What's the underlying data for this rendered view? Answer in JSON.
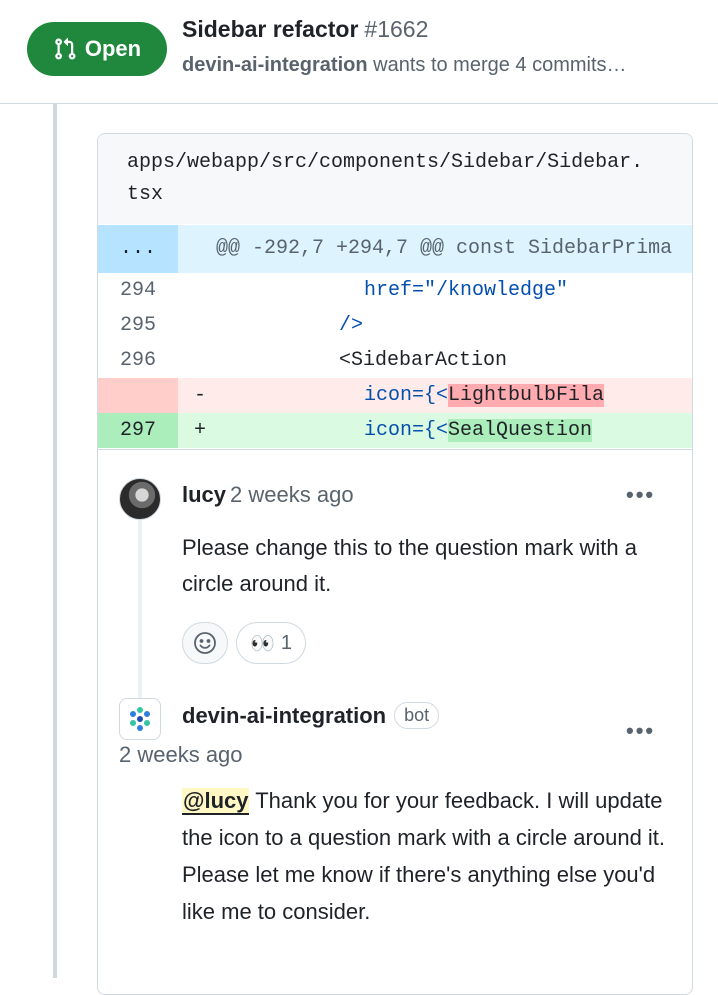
{
  "header": {
    "status_label": "Open",
    "title": "Sidebar refactor",
    "number": "#1662",
    "author": "devin-ai-integration",
    "meta_text": "wants to merge 4 commits…"
  },
  "file": {
    "path": "apps/webapp/src/components/Sidebar/Sidebar.tsx"
  },
  "diff": {
    "hunk_gutter": "...",
    "hunk_header": "@@ -292,7 +294,7 @@ const SidebarPrima",
    "lines": [
      {
        "num": "294",
        "sign": "",
        "code": "href=\"/knowledge\""
      },
      {
        "num": "295",
        "sign": "",
        "code": "/>"
      },
      {
        "num": "296",
        "sign": "",
        "code": "<SidebarAction"
      },
      {
        "num": "",
        "sign": "-",
        "code_prefix": "icon={<",
        "code_highlight": "LightbulbFila"
      },
      {
        "num": "297",
        "sign": "+",
        "code_prefix": "icon={<",
        "code_highlight": "SealQuestion"
      }
    ]
  },
  "comments": [
    {
      "author": "lucy",
      "time": "2 weeks ago",
      "more": "•••",
      "body": "Please change this to the question mark with a circle around it.",
      "reactions": [
        {
          "emoji": "😊",
          "count": ""
        },
        {
          "emoji": "👀",
          "count": "1"
        }
      ]
    },
    {
      "author": "devin-ai-integration",
      "badge": "bot",
      "time": "2 weeks ago",
      "more": "•••",
      "mention": "@lucy",
      "body": " Thank you for your feedback. I will update the icon to a question mark with a circle around it. Please let me know if there's anything else you'd like me to consider."
    }
  ],
  "colors": {
    "open_green": "#1f883d",
    "deletion_bg": "#ffebe9",
    "addition_bg": "#dafbe1",
    "hunk_bg": "#ddf4ff"
  }
}
